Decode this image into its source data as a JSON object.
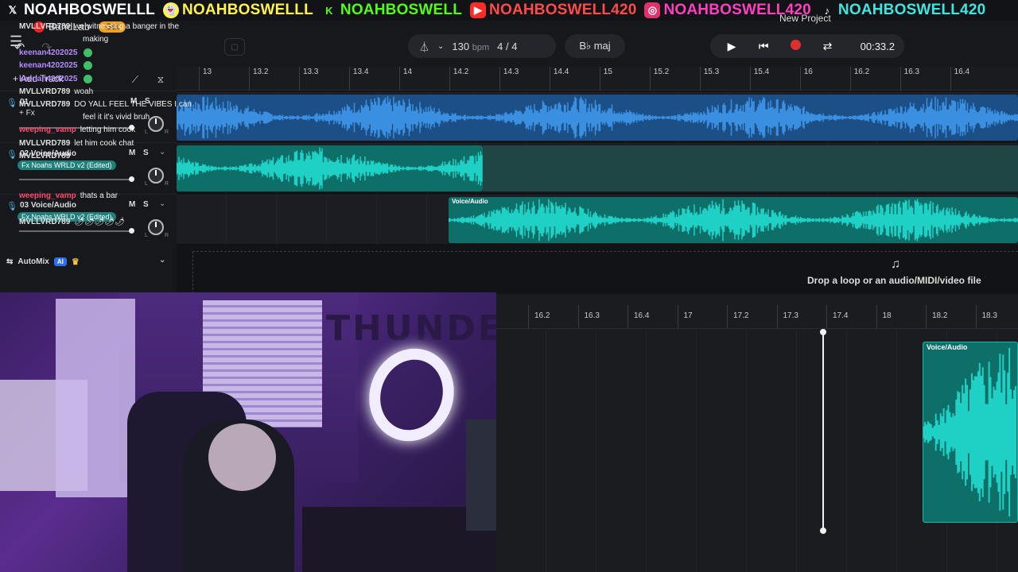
{
  "banner": [
    {
      "icon": "x-icon",
      "text": "NOAHBOSWELLL"
    },
    {
      "icon": "snapchat-icon",
      "text": "NOAHBOSWELLL"
    },
    {
      "icon": "kick-icon",
      "text": "NOAHBOSWELL"
    },
    {
      "icon": "youtube-icon",
      "text": "NOAHBOSWELL420"
    },
    {
      "icon": "instagram-icon",
      "text": "NOAHBOSWELL420"
    },
    {
      "icon": "tiktok-icon",
      "text": "NOAHBOSWELL420"
    }
  ],
  "app": {
    "brand": "BandLab",
    "get_label": "Get",
    "project_title": "New Project",
    "add_track_label": "+ Add Track"
  },
  "toolbar": {
    "tempo": "130",
    "tempo_unit": "bpm",
    "time_signature": "4 / 4",
    "key": "B♭ maj",
    "time": "00:33.2"
  },
  "ruler_labels": [
    "13",
    "13.2",
    "13.3",
    "13.4",
    "14",
    "14.2",
    "14.3",
    "14.4",
    "15",
    "15.2",
    "15.3",
    "15.4",
    "16",
    "16.2",
    "16.3",
    "16.4"
  ],
  "tracks": [
    {
      "number": "01",
      "name": "",
      "fx": "+ Fx",
      "mute": "M",
      "solo": "S"
    },
    {
      "number": "02",
      "name": "Voice/Audio",
      "fx": "Fx Noahs WRLD v2 (Edited)",
      "mute": "M",
      "solo": "S"
    },
    {
      "number": "03",
      "name": "Voice/Audio",
      "fx": "Fx Noahs WRLD v2 (Edited)",
      "mute": "M",
      "solo": "S"
    }
  ],
  "pan_labels": {
    "left": "L",
    "right": "R"
  },
  "clips": {
    "track3_label": "Voice/Audio",
    "zoom_label": "Voice/Audio"
  },
  "automix": {
    "label": "AutoMix",
    "badge": "AI"
  },
  "dropzone": {
    "text": "Drop a loop or an audio/MIDI/video file"
  },
  "zoom_ruler_labels": [
    "16.2",
    "16.3",
    "16.4",
    "17",
    "17.2",
    "17.3",
    "17.4",
    "18",
    "18.2",
    "18.3"
  ],
  "chat": [
    {
      "user": "MVLLVRD789",
      "text": "we witnessing a banger in the",
      "color": "white"
    },
    {
      "user": "",
      "text": "making",
      "color": "white"
    },
    {
      "user": "keenan4202025",
      "text": "",
      "color": "purple",
      "emoji": true
    },
    {
      "user": "keenan4202025",
      "text": "",
      "color": "purple",
      "emoji": true
    },
    {
      "user": "keenan4202025",
      "text": "",
      "color": "purple",
      "emoji": true
    },
    {
      "user": "MVLLVRD789",
      "text": "woah",
      "color": "white"
    },
    {
      "user": "MVLLVRD789",
      "text": "DO YALL FEEL THE VIBES I can",
      "color": "white"
    },
    {
      "user": "",
      "text": "feel it it's vivid bruh",
      "color": "white"
    },
    {
      "user": "weeping_vamp",
      "text": "letting him cook",
      "color": "red"
    },
    {
      "user": "MVLLVRD789",
      "text": "let him cook chat",
      "color": "white"
    },
    {
      "user": "MVLLVRD789",
      "text": "",
      "color": "white"
    },
    {
      "user": "weeping_vamp",
      "text": "thats a bar",
      "color": "red"
    },
    {
      "user": "MVLLVRD789",
      "text": "🌶🌶🌶🌶🌶",
      "color": "white"
    }
  ],
  "colors": {
    "clip_blue": "#3b8fe0",
    "clip_teal": "#1fd1c5",
    "record": "#e0302e",
    "accent_ai": "#2d6ef2"
  }
}
